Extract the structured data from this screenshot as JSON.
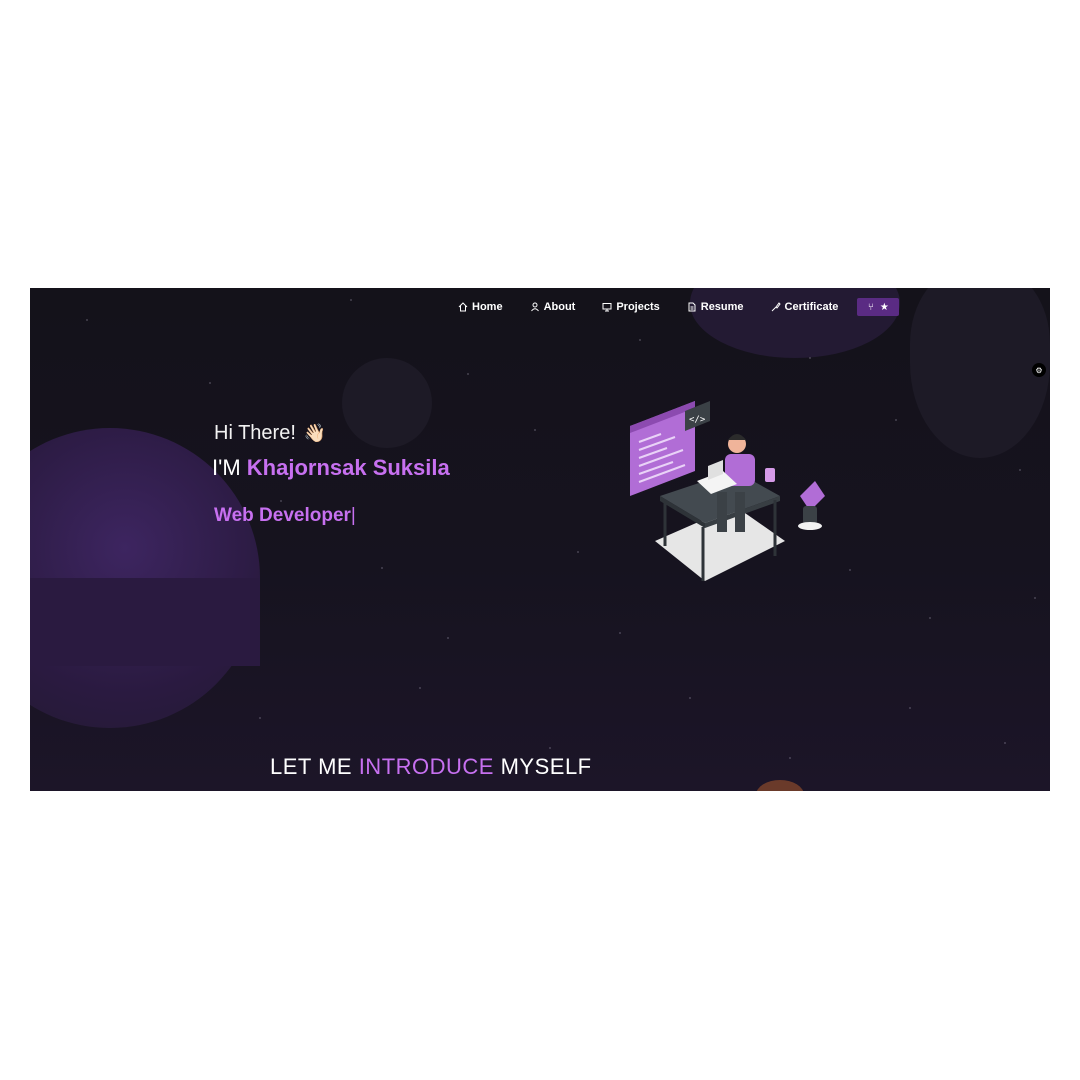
{
  "nav": {
    "items": [
      {
        "label": "Home",
        "icon": "home-icon"
      },
      {
        "label": "About",
        "icon": "user-icon"
      },
      {
        "label": "Projects",
        "icon": "projects-icon"
      },
      {
        "label": "Resume",
        "icon": "document-icon"
      },
      {
        "label": "Certificate",
        "icon": "certificate-icon"
      }
    ],
    "github_button_icons": [
      "fork-icon",
      "star-icon"
    ]
  },
  "hero": {
    "greeting": "Hi There!",
    "wave_emoji": "👋🏻",
    "name_prefix": "I'M",
    "name": "Khajornsak Suksila",
    "role": "Web Developer",
    "cursor": "|"
  },
  "intro": {
    "part1": "LET ME",
    "highlight": "INTRODUCE",
    "part2": "MYSELF"
  },
  "colors": {
    "accent": "#c770f0",
    "background": "#14121a",
    "button": "#5a2b83"
  }
}
